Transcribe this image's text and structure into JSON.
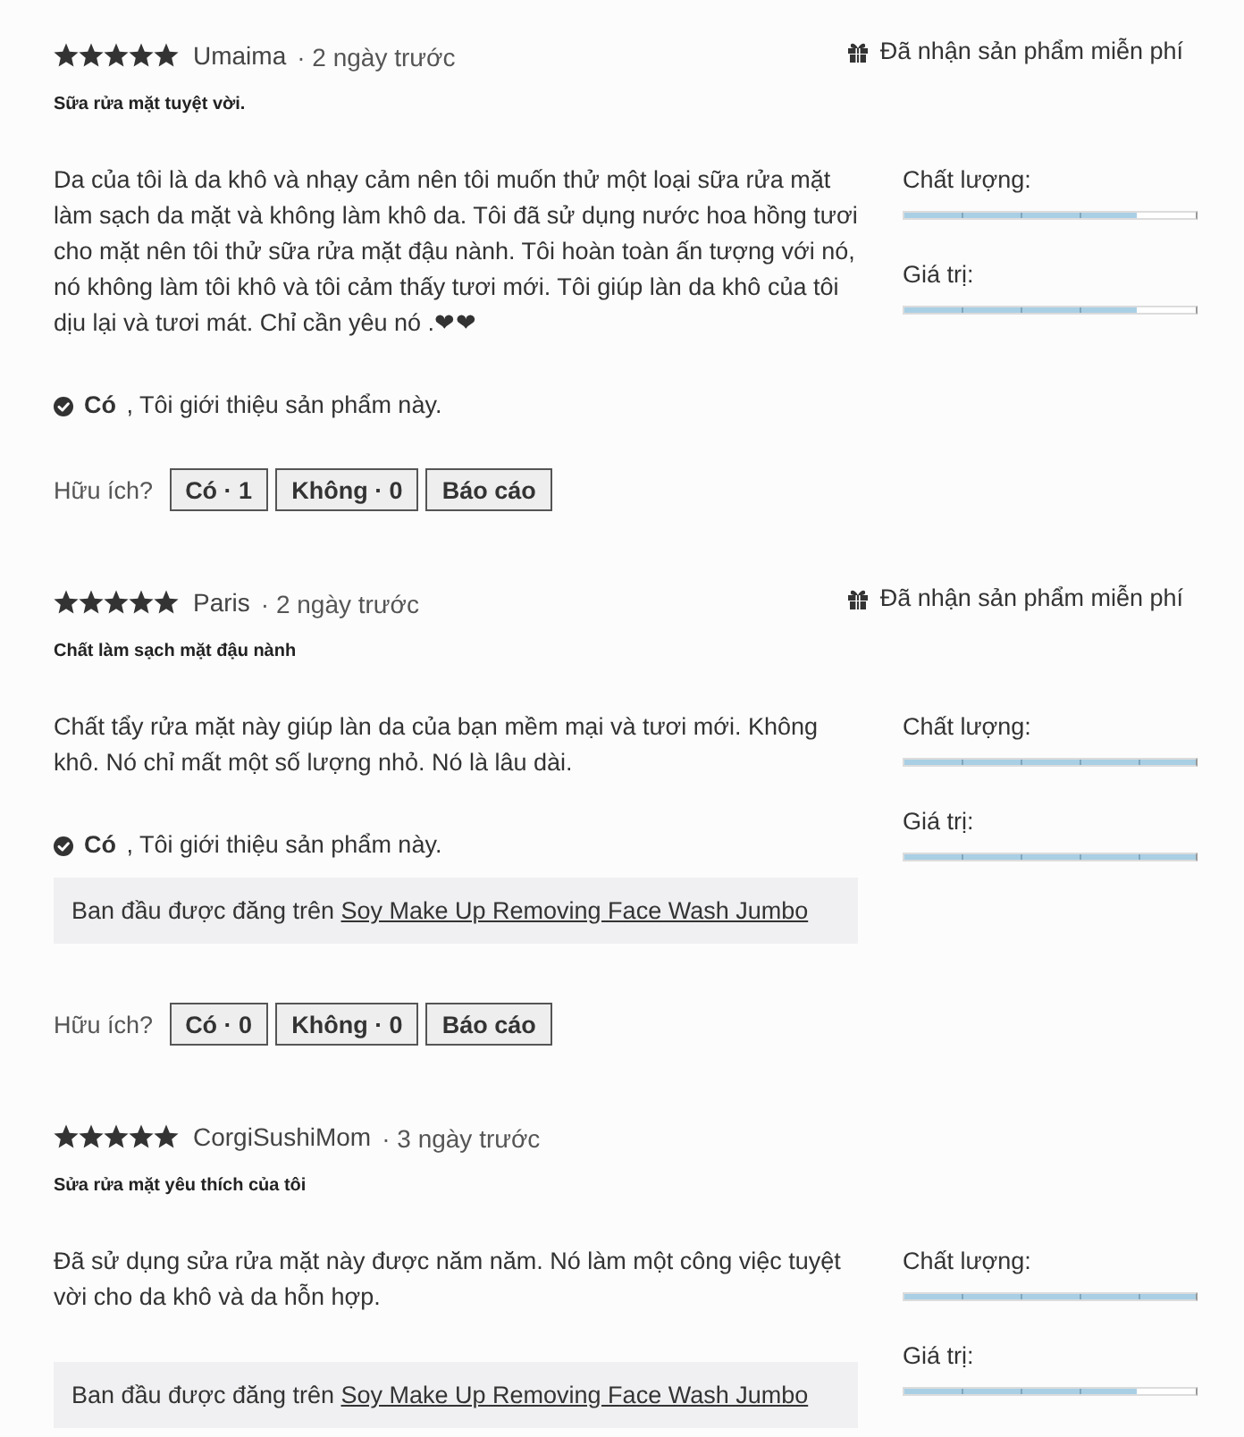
{
  "reviews": [
    {
      "stars": 5,
      "author": "Umaima",
      "time": "· 2 ngày trước",
      "badge": "Đã nhận sản phẩm miễn phí",
      "title": "Sữa rửa mặt tuyệt vời.",
      "body": "Da của tôi là da khô và nhạy cảm nên tôi muốn thử một loại sữa rửa mặt làm sạch da mặt và không làm khô da. Tôi đã sử dụng nước hoa hồng tươi cho mặt nên tôi thử sữa rửa mặt đậu nành. Tôi hoàn toàn ấn tượng với nó, nó không làm tôi khô và tôi cảm thấy tươi mới. Tôi giúp làn da khô của tôi dịu lại và tươi mát. Chỉ cần yêu nó .❤❤",
      "recommend": "**Có** ,  Tôi giới thiệu sản phẩm này.",
      "ratings": [
        {
          "label": "Chất lượng:",
          "level": 0.8
        },
        {
          "label": "Giá trị:",
          "level": 0.8
        }
      ],
      "helpful": {
        "label": "Hữu ích?",
        "buttons": [
          "Có · 1",
          "Không · 0",
          "Báo cáo"
        ]
      }
    },
    {
      "stars": 5,
      "author": "Paris",
      "time": "· 2 ngày trước",
      "badge": "Đã nhận sản phẩm miễn phí",
      "title": "Chất làm sạch mặt đậu nành",
      "body": "Chất tẩy rửa mặt này giúp làn da của bạn mềm mại và tươi mới. Không khô. Nó chỉ mất một số lượng nhỏ. Nó là lâu dài.",
      "recommend": "**Có** ,  Tôi giới thiệu sản phẩm này.",
      "origin": {
        "text": "Ban đầu được đăng trên",
        "link": "Soy Make Up Removing Face Wash Jumbo"
      },
      "ratings": [
        {
          "label": "Chất lượng:",
          "level": 1
        },
        {
          "label": "Giá trị:",
          "level": 1
        }
      ],
      "helpful": {
        "label": "Hữu ích?",
        "buttons": [
          "Có · 0",
          "Không · 0",
          "Báo cáo"
        ]
      }
    },
    {
      "stars": 5,
      "author": "CorgiSushiMom",
      "time": "· 3 ngày trước",
      "title": "Sửa rửa mặt yêu thích của tôi",
      "body": "Đã sử dụng sửa rửa mặt này được năm năm. Nó làm một công việc tuyệt vời cho da khô và da hỗn hợp.",
      "origin": {
        "text": "Ban đầu được đăng trên",
        "link": "Soy Make Up Removing Face Wash Jumbo"
      },
      "ratings": [
        {
          "label": "Chất lượng:",
          "level": 1
        },
        {
          "label": "Giá trị:",
          "level": 0.8
        }
      ]
    }
  ]
}
